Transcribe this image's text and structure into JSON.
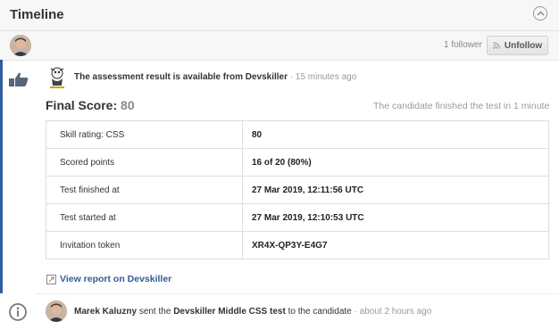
{
  "header": {
    "title": "Timeline"
  },
  "followbar": {
    "follower_count": "1 follower",
    "unfollow_label": "Unfollow"
  },
  "event1": {
    "headline": "The assessment result is available from Devskiller",
    "time": "15 minutes ago",
    "final_score_label": "Final Score:",
    "final_score_value": "80",
    "finished_note": "The candidate finished the test in 1 minute",
    "rows": [
      {
        "key": "Skill rating: CSS",
        "value": "80"
      },
      {
        "key": "Scored points",
        "value": "16 of 20 (80%)"
      },
      {
        "key": "Test finished at",
        "value": "27 Mar 2019, 12:11:56 UTC"
      },
      {
        "key": "Test started at",
        "value": "27 Mar 2019, 12:10:53 UTC"
      },
      {
        "key": "Invitation token",
        "value": "XR4X-QP3Y-E4G7"
      }
    ],
    "report_link": "View report on Devskiller"
  },
  "event2": {
    "actor": "Marek Kaluzny",
    "verb": "sent the",
    "object": "Devskiller Middle CSS test",
    "suffix": "to the candidate",
    "time": "about 2 hours ago"
  },
  "colors": {
    "accent": "#2f5f9a",
    "muted": "#999999",
    "header_bg": "#f7f7f7"
  },
  "icons": [
    "chevron-up-icon",
    "rss-icon",
    "thumbs-up-icon",
    "devskiller-logo",
    "external-link-icon",
    "info-icon"
  ]
}
